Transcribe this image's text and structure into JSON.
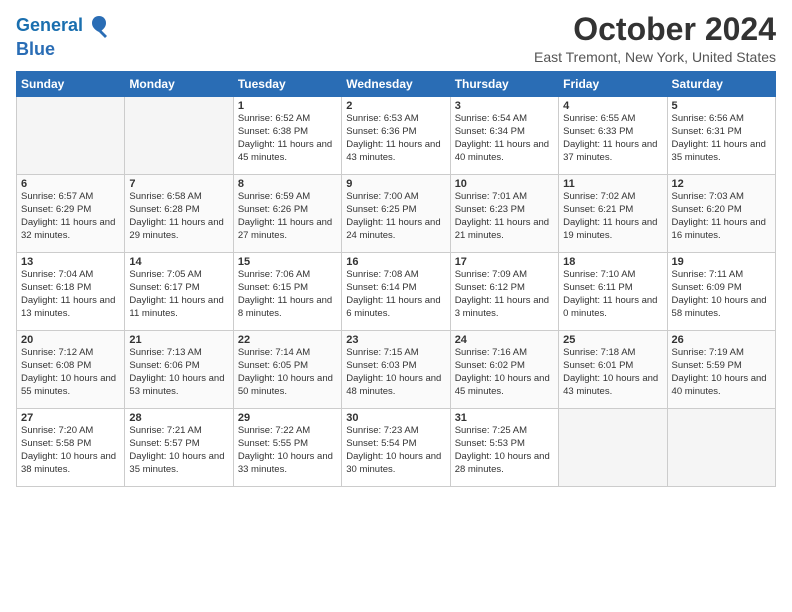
{
  "header": {
    "logo_line1": "General",
    "logo_line2": "Blue",
    "month": "October 2024",
    "location": "East Tremont, New York, United States"
  },
  "weekdays": [
    "Sunday",
    "Monday",
    "Tuesday",
    "Wednesday",
    "Thursday",
    "Friday",
    "Saturday"
  ],
  "weeks": [
    [
      {
        "day": "",
        "text": ""
      },
      {
        "day": "",
        "text": ""
      },
      {
        "day": "1",
        "text": "Sunrise: 6:52 AM\nSunset: 6:38 PM\nDaylight: 11 hours and 45 minutes."
      },
      {
        "day": "2",
        "text": "Sunrise: 6:53 AM\nSunset: 6:36 PM\nDaylight: 11 hours and 43 minutes."
      },
      {
        "day": "3",
        "text": "Sunrise: 6:54 AM\nSunset: 6:34 PM\nDaylight: 11 hours and 40 minutes."
      },
      {
        "day": "4",
        "text": "Sunrise: 6:55 AM\nSunset: 6:33 PM\nDaylight: 11 hours and 37 minutes."
      },
      {
        "day": "5",
        "text": "Sunrise: 6:56 AM\nSunset: 6:31 PM\nDaylight: 11 hours and 35 minutes."
      }
    ],
    [
      {
        "day": "6",
        "text": "Sunrise: 6:57 AM\nSunset: 6:29 PM\nDaylight: 11 hours and 32 minutes."
      },
      {
        "day": "7",
        "text": "Sunrise: 6:58 AM\nSunset: 6:28 PM\nDaylight: 11 hours and 29 minutes."
      },
      {
        "day": "8",
        "text": "Sunrise: 6:59 AM\nSunset: 6:26 PM\nDaylight: 11 hours and 27 minutes."
      },
      {
        "day": "9",
        "text": "Sunrise: 7:00 AM\nSunset: 6:25 PM\nDaylight: 11 hours and 24 minutes."
      },
      {
        "day": "10",
        "text": "Sunrise: 7:01 AM\nSunset: 6:23 PM\nDaylight: 11 hours and 21 minutes."
      },
      {
        "day": "11",
        "text": "Sunrise: 7:02 AM\nSunset: 6:21 PM\nDaylight: 11 hours and 19 minutes."
      },
      {
        "day": "12",
        "text": "Sunrise: 7:03 AM\nSunset: 6:20 PM\nDaylight: 11 hours and 16 minutes."
      }
    ],
    [
      {
        "day": "13",
        "text": "Sunrise: 7:04 AM\nSunset: 6:18 PM\nDaylight: 11 hours and 13 minutes."
      },
      {
        "day": "14",
        "text": "Sunrise: 7:05 AM\nSunset: 6:17 PM\nDaylight: 11 hours and 11 minutes."
      },
      {
        "day": "15",
        "text": "Sunrise: 7:06 AM\nSunset: 6:15 PM\nDaylight: 11 hours and 8 minutes."
      },
      {
        "day": "16",
        "text": "Sunrise: 7:08 AM\nSunset: 6:14 PM\nDaylight: 11 hours and 6 minutes."
      },
      {
        "day": "17",
        "text": "Sunrise: 7:09 AM\nSunset: 6:12 PM\nDaylight: 11 hours and 3 minutes."
      },
      {
        "day": "18",
        "text": "Sunrise: 7:10 AM\nSunset: 6:11 PM\nDaylight: 11 hours and 0 minutes."
      },
      {
        "day": "19",
        "text": "Sunrise: 7:11 AM\nSunset: 6:09 PM\nDaylight: 10 hours and 58 minutes."
      }
    ],
    [
      {
        "day": "20",
        "text": "Sunrise: 7:12 AM\nSunset: 6:08 PM\nDaylight: 10 hours and 55 minutes."
      },
      {
        "day": "21",
        "text": "Sunrise: 7:13 AM\nSunset: 6:06 PM\nDaylight: 10 hours and 53 minutes."
      },
      {
        "day": "22",
        "text": "Sunrise: 7:14 AM\nSunset: 6:05 PM\nDaylight: 10 hours and 50 minutes."
      },
      {
        "day": "23",
        "text": "Sunrise: 7:15 AM\nSunset: 6:03 PM\nDaylight: 10 hours and 48 minutes."
      },
      {
        "day": "24",
        "text": "Sunrise: 7:16 AM\nSunset: 6:02 PM\nDaylight: 10 hours and 45 minutes."
      },
      {
        "day": "25",
        "text": "Sunrise: 7:18 AM\nSunset: 6:01 PM\nDaylight: 10 hours and 43 minutes."
      },
      {
        "day": "26",
        "text": "Sunrise: 7:19 AM\nSunset: 5:59 PM\nDaylight: 10 hours and 40 minutes."
      }
    ],
    [
      {
        "day": "27",
        "text": "Sunrise: 7:20 AM\nSunset: 5:58 PM\nDaylight: 10 hours and 38 minutes."
      },
      {
        "day": "28",
        "text": "Sunrise: 7:21 AM\nSunset: 5:57 PM\nDaylight: 10 hours and 35 minutes."
      },
      {
        "day": "29",
        "text": "Sunrise: 7:22 AM\nSunset: 5:55 PM\nDaylight: 10 hours and 33 minutes."
      },
      {
        "day": "30",
        "text": "Sunrise: 7:23 AM\nSunset: 5:54 PM\nDaylight: 10 hours and 30 minutes."
      },
      {
        "day": "31",
        "text": "Sunrise: 7:25 AM\nSunset: 5:53 PM\nDaylight: 10 hours and 28 minutes."
      },
      {
        "day": "",
        "text": ""
      },
      {
        "day": "",
        "text": ""
      }
    ]
  ]
}
